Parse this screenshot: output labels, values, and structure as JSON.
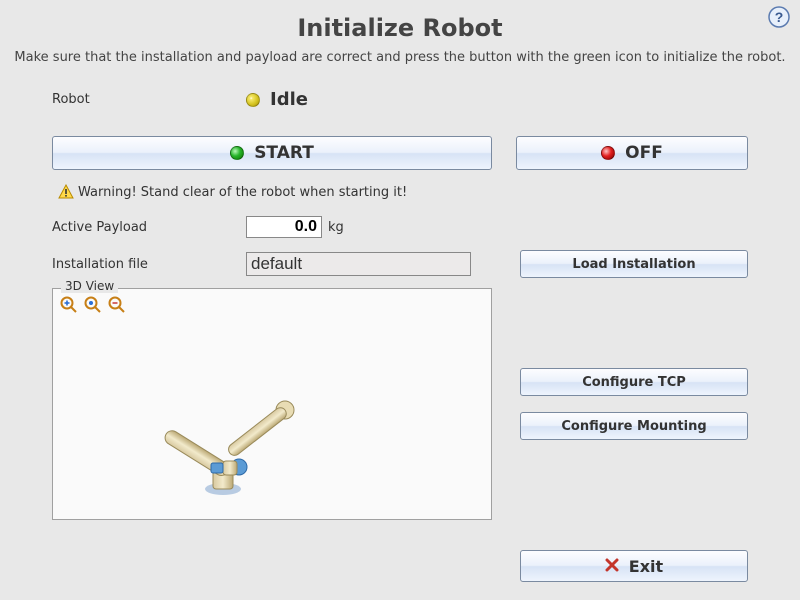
{
  "header": {
    "title": "Initialize Robot",
    "subtitle": "Make sure that the installation and payload are correct and press the button with the green icon to initialize the robot."
  },
  "status": {
    "label": "Robot",
    "value": "Idle",
    "color": "#d6c623"
  },
  "buttons": {
    "start": "START",
    "off": "OFF",
    "load_installation": "Load Installation",
    "configure_tcp": "Configure TCP",
    "configure_mounting": "Configure Mounting",
    "exit": "Exit"
  },
  "warning": {
    "text": "Warning! Stand clear of the robot when starting it!"
  },
  "payload": {
    "label": "Active Payload",
    "value": "0.0",
    "unit": "kg"
  },
  "installation": {
    "label": "Installation file",
    "value": "default"
  },
  "view": {
    "legend": "3D View"
  },
  "icons": {
    "help": "help-icon",
    "zoom_in": "zoom-in-icon",
    "zoom_home": "zoom-home-icon",
    "zoom_out": "zoom-out-icon",
    "warning": "warning-icon",
    "close_x": "close-icon"
  }
}
